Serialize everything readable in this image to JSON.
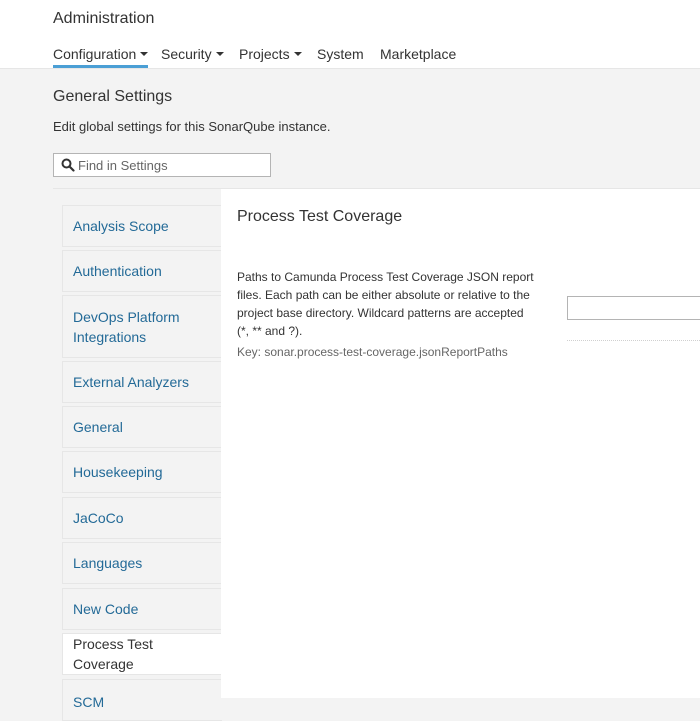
{
  "header": {
    "title": "Administration",
    "nav": [
      {
        "label": "Configuration",
        "dropdown": true,
        "active": true
      },
      {
        "label": "Security",
        "dropdown": true,
        "active": false
      },
      {
        "label": "Projects",
        "dropdown": true,
        "active": false
      },
      {
        "label": "System",
        "dropdown": false,
        "active": false
      },
      {
        "label": "Marketplace",
        "dropdown": false,
        "active": false
      }
    ]
  },
  "page": {
    "title": "General Settings",
    "description": "Edit global settings for this SonarQube instance."
  },
  "search": {
    "placeholder": "Find in Settings",
    "value": "",
    "icon": "search-icon"
  },
  "sidebar": {
    "items": [
      {
        "label": "Analysis Scope"
      },
      {
        "label": "Authentication"
      },
      {
        "label": "DevOps Platform Integrations"
      },
      {
        "label": "External Analyzers"
      },
      {
        "label": "General"
      },
      {
        "label": "Housekeeping"
      },
      {
        "label": "JaCoCo"
      },
      {
        "label": "Languages"
      },
      {
        "label": "New Code"
      },
      {
        "label": "Process Test Coverage",
        "active": true
      },
      {
        "label": "SCM"
      }
    ]
  },
  "main": {
    "section_title": "Process Test Coverage",
    "setting": {
      "description": "Paths to Camunda Process Test Coverage JSON report files. Each path can be either absolute or relative to the project base directory. Wildcard patterns are accepted (*, ** and ?).",
      "key": "Key: sonar.process-test-coverage.jsonReportPaths",
      "value": ""
    }
  },
  "colors": {
    "accent": "#4b9fd5",
    "link": "#236a97",
    "background": "#f3f3f3",
    "panel": "#ffffff"
  }
}
